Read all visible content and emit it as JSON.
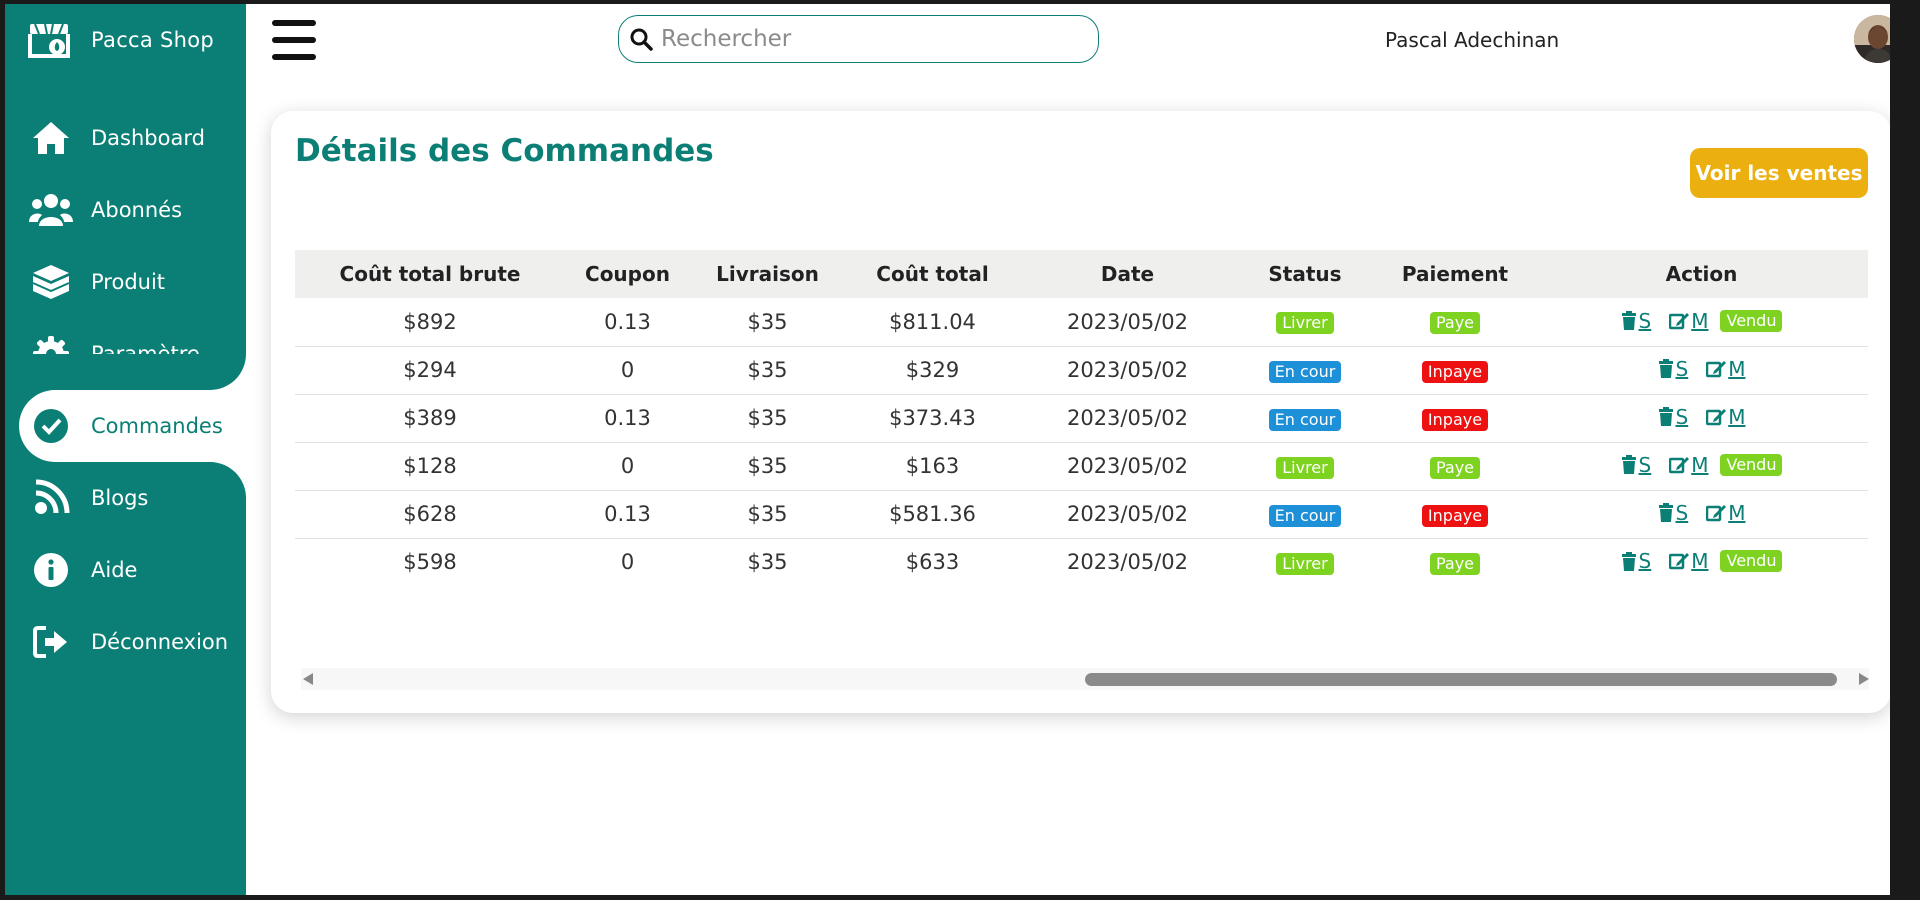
{
  "brand": {
    "name": "Pacca Shop"
  },
  "sidebar": {
    "items": [
      {
        "label": "Dashboard",
        "icon": "home-icon"
      },
      {
        "label": "Abonnés",
        "icon": "users-icon"
      },
      {
        "label": "Produit",
        "icon": "box-icon"
      },
      {
        "label": "Paramètre",
        "icon": "gear-icon"
      },
      {
        "label": "Commandes",
        "icon": "check-circle-icon",
        "active": true
      },
      {
        "label": "Blogs",
        "icon": "blog-icon"
      },
      {
        "label": "Aide",
        "icon": "info-icon"
      },
      {
        "label": "Déconnexion",
        "icon": "logout-icon"
      }
    ]
  },
  "header": {
    "search_placeholder": "Rechercher",
    "username": "Pascal Adechinan"
  },
  "orders": {
    "title": "Détails des Commandes",
    "sales_button": "Voir les ventes",
    "columns": [
      "Coût total brute",
      "Coupon",
      "Livraison",
      "Coût total",
      "Date",
      "Status",
      "Paiement",
      "Action"
    ],
    "rows": [
      {
        "gross": "$892",
        "coupon": "0.13",
        "delivery": "$35",
        "total": "$811.04",
        "date": "2023/05/02",
        "status": "Livrer",
        "payment": "Paye",
        "delete": "S",
        "edit": "M",
        "sold": "Vendu"
      },
      {
        "gross": "$294",
        "coupon": "0",
        "delivery": "$35",
        "total": "$329",
        "date": "2023/05/02",
        "status": "En cour",
        "payment": "Inpaye",
        "delete": "S",
        "edit": "M",
        "sold": ""
      },
      {
        "gross": "$389",
        "coupon": "0.13",
        "delivery": "$35",
        "total": "$373.43",
        "date": "2023/05/02",
        "status": "En cour",
        "payment": "Inpaye",
        "delete": "S",
        "edit": "M",
        "sold": ""
      },
      {
        "gross": "$128",
        "coupon": "0",
        "delivery": "$35",
        "total": "$163",
        "date": "2023/05/02",
        "status": "Livrer",
        "payment": "Paye",
        "delete": "S",
        "edit": "M",
        "sold": "Vendu"
      },
      {
        "gross": "$628",
        "coupon": "0.13",
        "delivery": "$35",
        "total": "$581.36",
        "date": "2023/05/02",
        "status": "En cour",
        "payment": "Inpaye",
        "delete": "S",
        "edit": "M",
        "sold": ""
      },
      {
        "gross": "$598",
        "coupon": "0",
        "delivery": "$35",
        "total": "$633",
        "date": "2023/05/02",
        "status": "Livrer",
        "payment": "Paye",
        "delete": "S",
        "edit": "M",
        "sold": "Vendu"
      }
    ]
  },
  "colors": {
    "primary": "#0b7f75",
    "accent": "#ebb010",
    "status_livrer": "#7ed321",
    "status_en_cour": "#1e90d8",
    "payment_inpaye": "#ee1111"
  }
}
